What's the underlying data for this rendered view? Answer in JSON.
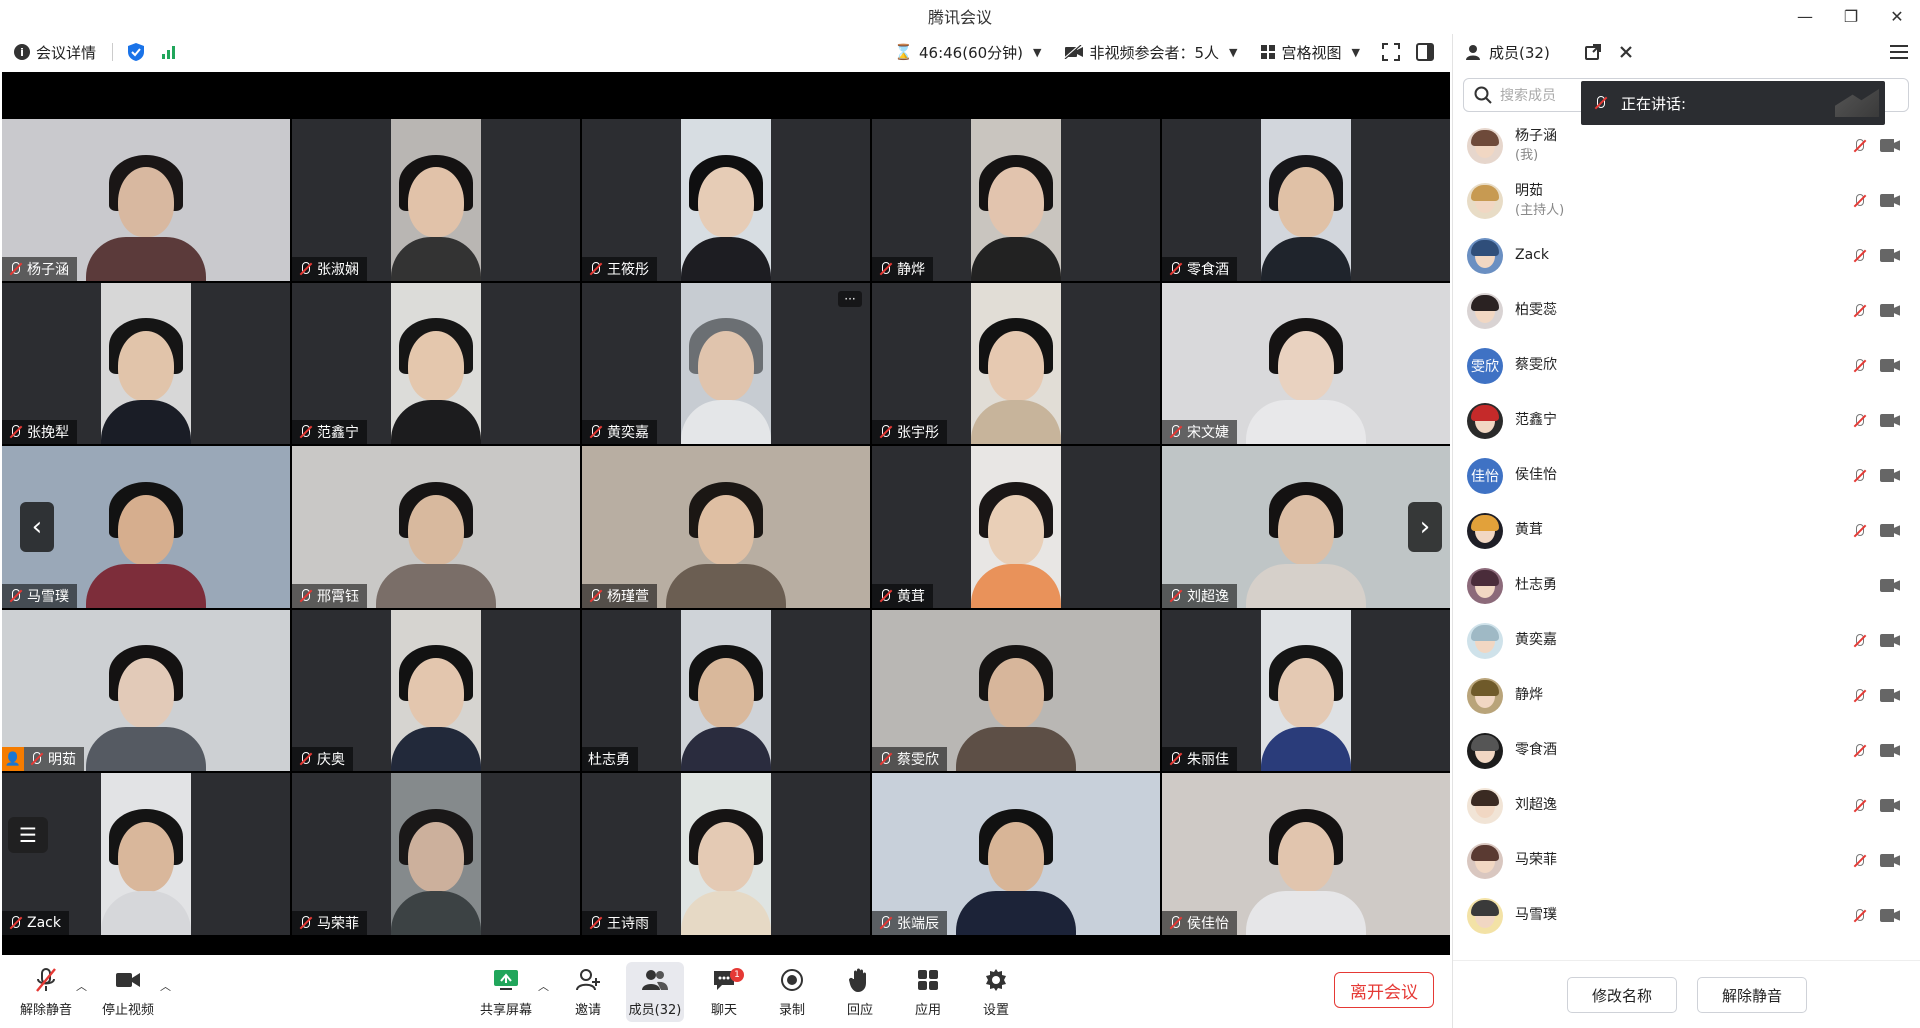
{
  "window": {
    "title": "腾讯会议",
    "minimize": "—",
    "restore": "❐",
    "close": "✕"
  },
  "infobar": {
    "meeting_details": "会议详情",
    "timer": "46:46(60分钟)",
    "non_video": "非视频参会者：5人",
    "view_mode": "宫格视图"
  },
  "tiles": [
    {
      "name": "杨子涵",
      "layout": "full",
      "bg": "#c9c9cd",
      "skin": "#d8b8a0",
      "hair": "#1a1616",
      "cloth": "#5b3a3a"
    },
    {
      "name": "张淑娴",
      "layout": "portrait",
      "bg": "#b9b6b3",
      "skin": "#e1c2a9",
      "hair": "#141212",
      "cloth": "#333"
    },
    {
      "name": "王筱彤",
      "layout": "portrait",
      "bg": "#d7dde2",
      "skin": "#e6ccb6",
      "hair": "#0f0f10",
      "cloth": "#1d1d22"
    },
    {
      "name": "静烨",
      "layout": "portrait",
      "bg": "#c9c5bf",
      "skin": "#e2c4ae",
      "hair": "#151313",
      "cloth": "#222"
    },
    {
      "name": "零食酒",
      "layout": "portrait",
      "bg": "#d2d6dc",
      "skin": "#e0c1a6",
      "hair": "#17171a",
      "cloth": "#1f242c"
    },
    {
      "name": "张挽犁",
      "layout": "portrait",
      "bg": "#d7d7d7",
      "skin": "#e1c4aa",
      "hair": "#151515",
      "cloth": "#1a1d26"
    },
    {
      "name": "范鑫宁",
      "layout": "portrait",
      "bg": "#dcdcd9",
      "skin": "#e4c7ad",
      "hair": "#161616",
      "cloth": "#1c1c1e"
    },
    {
      "name": "黄奕嘉",
      "layout": "portrait",
      "bg": "#c7ccd2",
      "skin": "#e0c4ad",
      "hair": "#6b6f73",
      "cloth": "#e4e6e8",
      "more": true
    },
    {
      "name": "张宇彤",
      "layout": "portrait",
      "bg": "#e1ddd6",
      "skin": "#e6c9b1",
      "hair": "#121212",
      "cloth": "#c7b49b"
    },
    {
      "name": "宋文婕",
      "layout": "full",
      "bg": "#d9d9db",
      "skin": "#e9d2c0",
      "hair": "#151313",
      "cloth": "#e8e8ea"
    },
    {
      "name": "马雪璞",
      "layout": "full",
      "bg": "#9aa8b8",
      "skin": "#d6ae8e",
      "hair": "#121212",
      "cloth": "#7d2d3a",
      "pager_left": true
    },
    {
      "name": "邢霄钰",
      "layout": "full",
      "bg": "#c9c8c6",
      "skin": "#d8b99e",
      "hair": "#161414",
      "cloth": "#7a6e68"
    },
    {
      "name": "杨瑾萱",
      "layout": "full",
      "bg": "#b8aea2",
      "skin": "#dfbfa3",
      "hair": "#1b1714",
      "cloth": "#6b5e52"
    },
    {
      "name": "黄茸",
      "layout": "portrait",
      "bg": "#e8e6e4",
      "skin": "#e9cfb7",
      "hair": "#1a1616",
      "cloth": "#e9925a"
    },
    {
      "name": "刘超逸",
      "layout": "full",
      "bg": "#bfc5c6",
      "skin": "#ddbfa6",
      "hair": "#141212",
      "cloth": "#d6d0ca",
      "pager_right": true
    },
    {
      "name": "明茹",
      "layout": "full",
      "bg": "#cdd0d3",
      "skin": "#e2cab8",
      "hair": "#141212",
      "cloth": "#555a62",
      "host": true
    },
    {
      "name": "庆奥",
      "layout": "portrait",
      "bg": "#d6d4d0",
      "skin": "#e3c6ae",
      "hair": "#121212",
      "cloth": "#22293a"
    },
    {
      "name": "杜志勇",
      "layout": "portrait",
      "bg": "#cfd3d8",
      "skin": "#d9b89b",
      "hair": "#121212",
      "cloth": "#2a2c3e",
      "unmuted": true
    },
    {
      "name": "蔡雯欣",
      "layout": "full",
      "bg": "#b9b7b4",
      "skin": "#d7b69b",
      "hair": "#161413",
      "cloth": "#5d4f46"
    },
    {
      "name": "朱丽佳",
      "layout": "portrait",
      "bg": "#dee1e4",
      "skin": "#e4c9b3",
      "hair": "#151515",
      "cloth": "#2a3c7a"
    },
    {
      "name": "Zack",
      "layout": "portrait",
      "bg": "#e2e3e5",
      "skin": "#d9b79b",
      "hair": "#141414",
      "cloth": "#d6d7da",
      "list_toggle": true
    },
    {
      "name": "马荣菲",
      "layout": "portrait",
      "bg": "#858a8c",
      "skin": "#ccb09c",
      "hair": "#1a1818",
      "cloth": "#3c4244"
    },
    {
      "name": "王诗雨",
      "layout": "portrait",
      "bg": "#dfe4e2",
      "skin": "#e4cab4",
      "hair": "#161414",
      "cloth": "#e6d9c5"
    },
    {
      "name": "张端辰",
      "layout": "full",
      "bg": "#c8d0da",
      "skin": "#d8b597",
      "hair": "#111",
      "cloth": "#1c2338"
    },
    {
      "name": "侯佳怡",
      "layout": "full",
      "bg": "#cfcac6",
      "skin": "#e1c5ae",
      "hair": "#141212",
      "cloth": "#e6e6e8"
    }
  ],
  "toolbar": {
    "unmute": "解除静音",
    "stop_video": "停止视频",
    "share_screen": "共享屏幕",
    "invite": "邀请",
    "members": "成员(32)",
    "chat": "聊天",
    "chat_badge": "1",
    "record": "录制",
    "reactions": "回应",
    "apps": "应用",
    "settings": "设置",
    "leave": "离开会议"
  },
  "panel": {
    "title": "成员(32)",
    "search_placeholder": "搜索成员",
    "speaking_label": "正在讲话:",
    "rename_button": "修改名称",
    "unmute_button": "解除静音",
    "members": [
      {
        "name": "杨子涵",
        "sub": "(我)",
        "avatar_bg": "#e6d6cc",
        "avatar_hair": "#6e4a3a",
        "muted": true
      },
      {
        "name": "明茹",
        "sub": "(主持人)",
        "avatar_bg": "#e8dcc6",
        "avatar_hair": "#c79a52",
        "muted": true
      },
      {
        "name": "Zack",
        "sub": "",
        "avatar_bg": "#6a8fc2",
        "avatar_hair": "#2f4e7a",
        "muted": true
      },
      {
        "name": "柏雯蕊",
        "sub": "",
        "avatar_bg": "#d9d3d3",
        "avatar_hair": "#2a2222",
        "muted": true
      },
      {
        "name": "蔡雯欣",
        "sub": "",
        "avatar_bg": "#3f72c4",
        "avatar_text": "雯欣",
        "muted": true
      },
      {
        "name": "范鑫宁",
        "sub": "",
        "avatar_bg": "#2a2a2a",
        "avatar_hair": "#c52a2a",
        "muted": true
      },
      {
        "name": "侯佳怡",
        "sub": "",
        "avatar_bg": "#3f72c4",
        "avatar_text": "佳怡",
        "muted": true
      },
      {
        "name": "黄茸",
        "sub": "",
        "avatar_bg": "#1e1e26",
        "avatar_hair": "#e2a13a",
        "muted": true
      },
      {
        "name": "杜志勇",
        "sub": "",
        "avatar_bg": "#8c6a7a",
        "avatar_hair": "#4a2c3a",
        "muted": false
      },
      {
        "name": "黄奕嘉",
        "sub": "",
        "avatar_bg": "#cfe2ea",
        "avatar_hair": "#9fb9c5",
        "muted": true
      },
      {
        "name": "静烨",
        "sub": "",
        "avatar_bg": "#b9a47a",
        "avatar_hair": "#6f5a2a",
        "muted": true
      },
      {
        "name": "零食酒",
        "sub": "",
        "avatar_bg": "#1c1c1c",
        "avatar_hair": "#555",
        "muted": true
      },
      {
        "name": "刘超逸",
        "sub": "",
        "avatar_bg": "#f1e4d6",
        "avatar_hair": "#3a2a22",
        "muted": true
      },
      {
        "name": "马荣菲",
        "sub": "",
        "avatar_bg": "#d9c7c0",
        "avatar_hair": "#5a3a32",
        "muted": true
      },
      {
        "name": "马雪璞",
        "sub": "",
        "avatar_bg": "#f3e2a6",
        "avatar_hair": "#3a3a3a",
        "muted": true
      }
    ]
  }
}
